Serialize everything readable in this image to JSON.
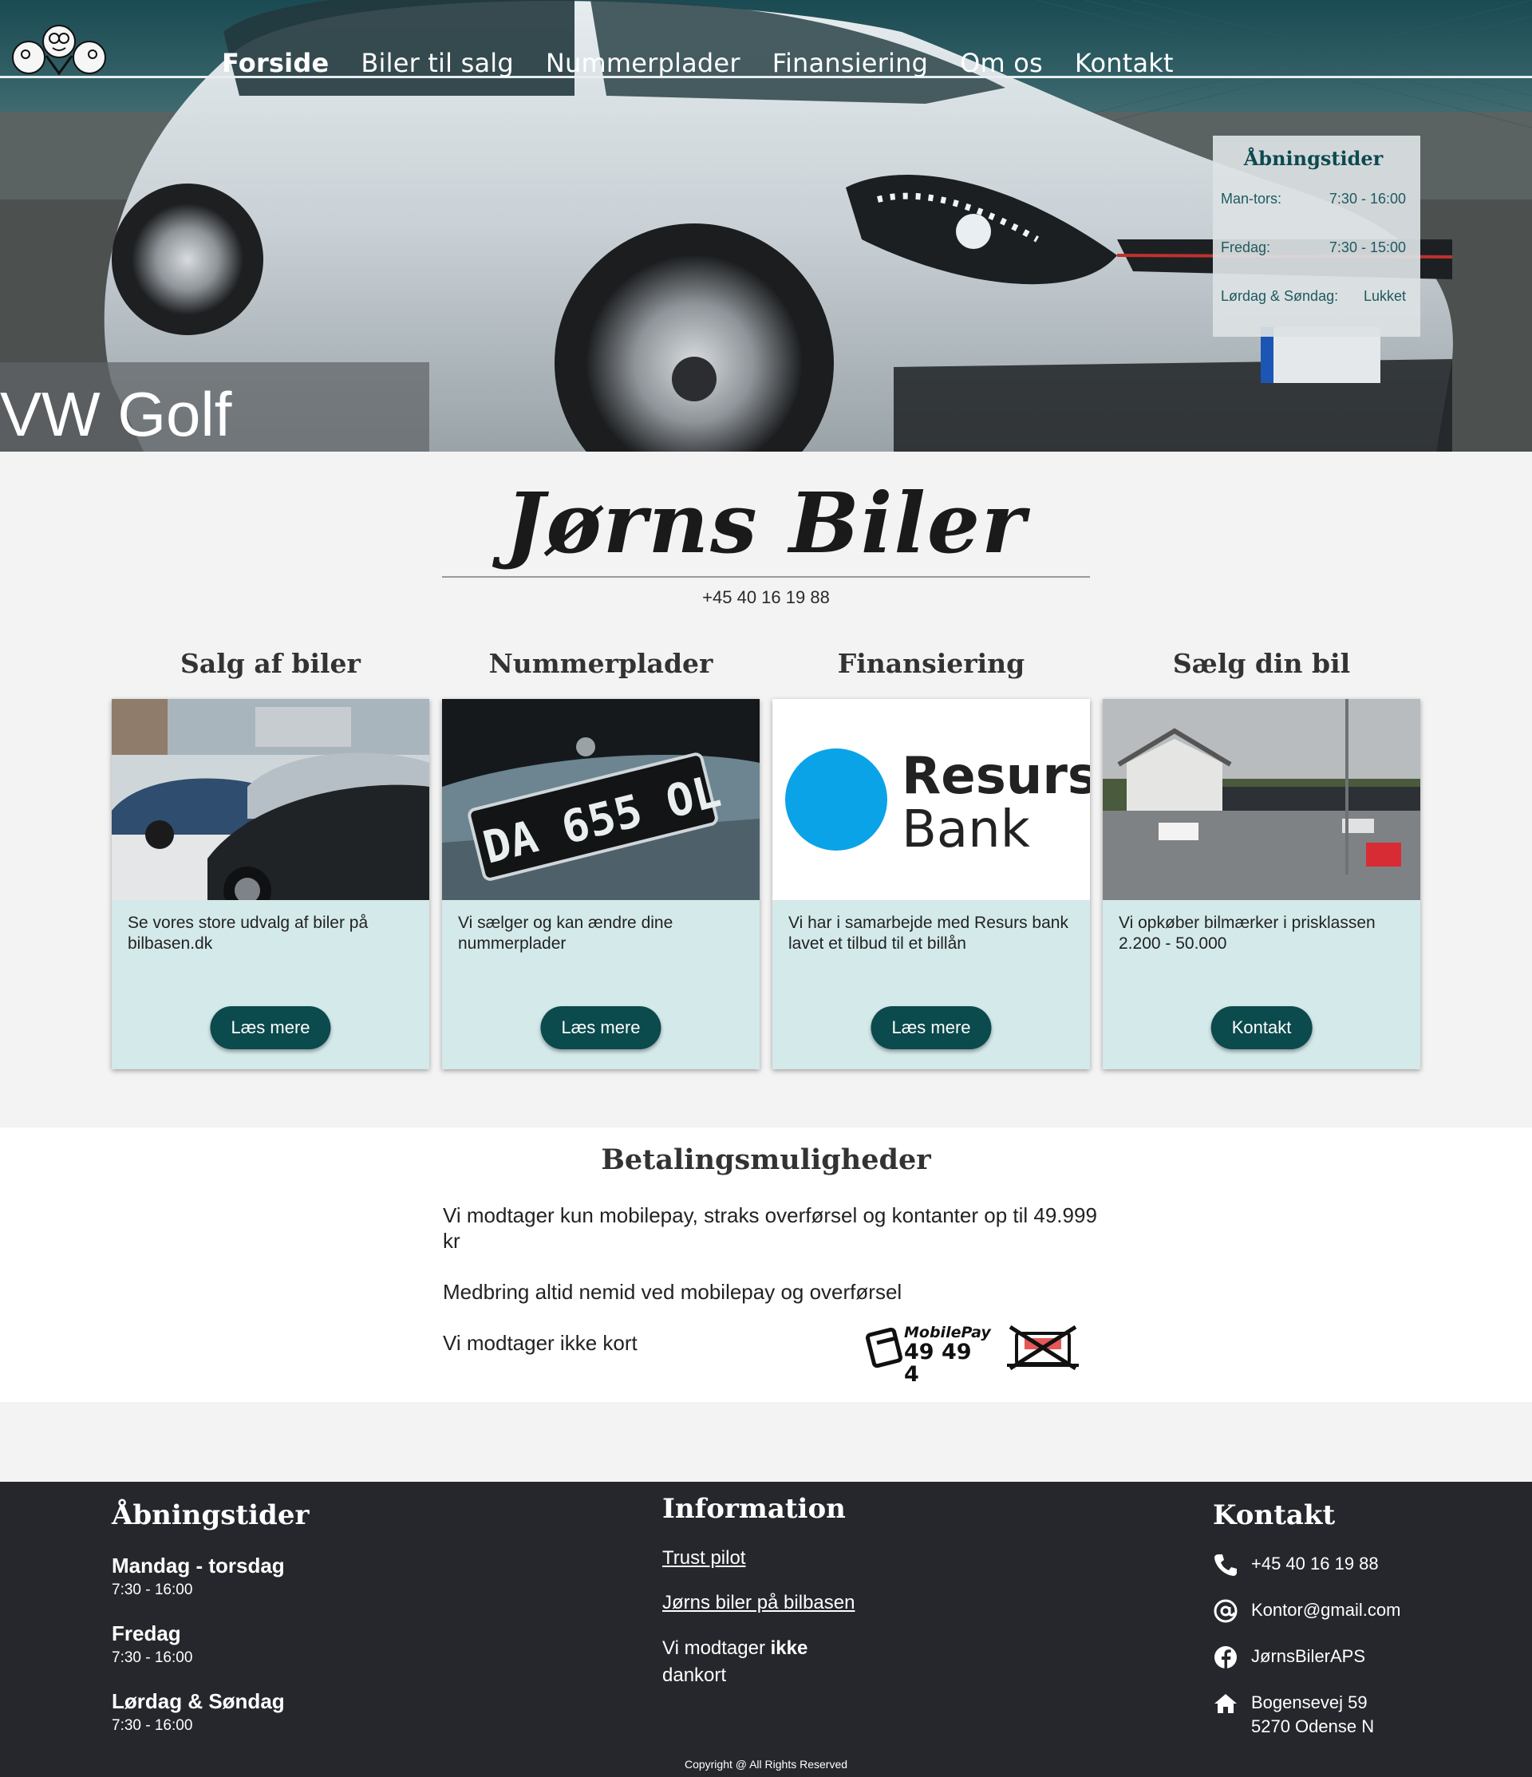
{
  "nav": {
    "items": [
      "Forside",
      "Biler til salg",
      "Nummerplader",
      "Finansiering",
      "Om os",
      "Kontakt"
    ],
    "active": "Forside"
  },
  "hero": {
    "caption": "VW Golf",
    "hours_box": {
      "title": "Åbningstider",
      "rows": [
        {
          "day": "Man-tors:",
          "time": "7:30 - 16:00"
        },
        {
          "day": "Fredag:",
          "time": "7:30 - 15:00"
        },
        {
          "day": "Lørdag & Søndag:",
          "time": "Lukket"
        }
      ]
    }
  },
  "brand": {
    "name": "Jørns Biler",
    "phone": "+45 40 16 19 88"
  },
  "cards": [
    {
      "title": "Salg af biler",
      "text": "Se vores store udvalg af biler på bilbasen.dk",
      "button": "Læs mere"
    },
    {
      "title": "Nummerplader",
      "text": "Vi sælger og kan ændre dine nummerplader",
      "button": "Læs mere",
      "plate_text": "DA 655 OL"
    },
    {
      "title": "Finansiering",
      "text": "Vi har i samarbejde med Resurs bank lavet et tilbud til et billån",
      "button": "Læs mere",
      "logo_line1": "Resurs",
      "logo_line2": "Bank"
    },
    {
      "title": "Sælg din bil",
      "text": "Vi opkøber bilmærker i prisklassen 2.200 - 50.000",
      "button": "Kontakt"
    }
  ],
  "payment": {
    "title": "Betalingsmuligheder",
    "line1": "Vi modtager kun mobilepay, straks overførsel og kontanter op til 49.999 kr",
    "line2": "Medbring altid nemid ved mobilepay og overførsel",
    "line3": "Vi modtager ikke kort",
    "mobilepay_brand": "MobilePay",
    "mobilepay_number": "49 49 4"
  },
  "footer": {
    "hours": {
      "title": "Åbningstider",
      "entries": [
        {
          "day": "Mandag - torsdag",
          "time": "7:30 - 16:00"
        },
        {
          "day": "Fredag",
          "time": "7:30 - 16:00"
        },
        {
          "day": "Lørdag & Søndag",
          "time": "7:30 - 16:00"
        }
      ]
    },
    "info": {
      "title": "Information",
      "links": [
        "Trust pilot",
        "Jørns biler på bilbasen"
      ],
      "note_prefix": "Vi modtager",
      "note_bold": "ikke",
      "note_suffix": "dankort"
    },
    "contact": {
      "title": "Kontakt",
      "phone": "+45 40 16 19 88",
      "email": "Kontor@gmail.com",
      "facebook": "JørnsBilerAPS",
      "address_line1": "Bogensevej 59",
      "address_line2": "5270 Odense N"
    },
    "copyright": "Copyright @ All Rights Reserved"
  },
  "colors": {
    "accent": "#0b4a4d",
    "card_bg": "#d4e9ea",
    "footer_bg": "#26272c",
    "page_bg": "#f3f3f3",
    "resurs_blue": "#0aa3e8"
  }
}
